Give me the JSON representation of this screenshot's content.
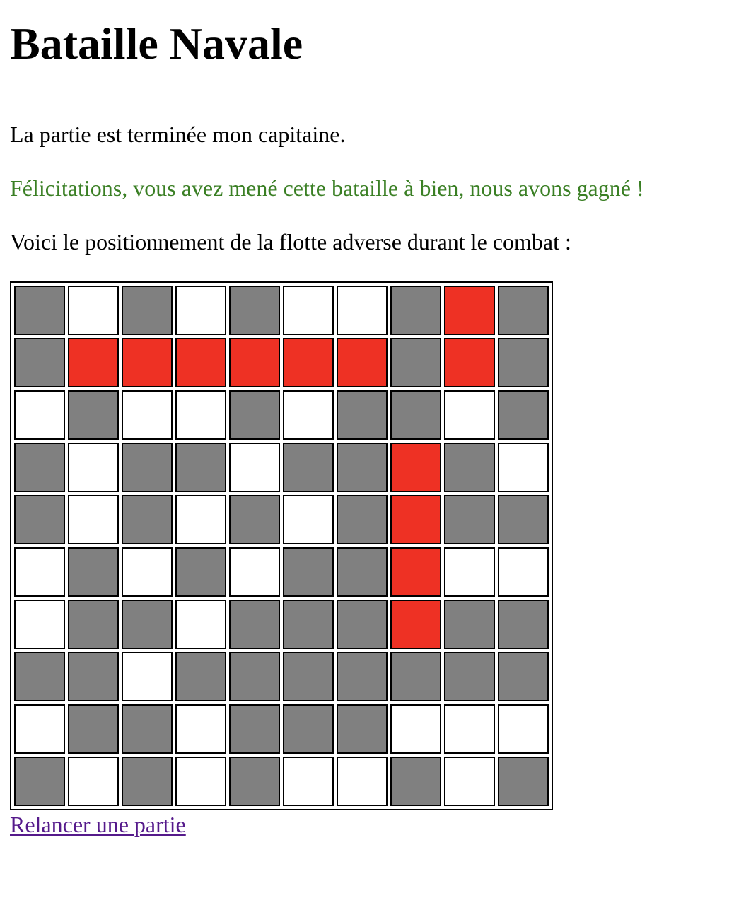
{
  "title": "Bataille Navale",
  "status_text": "La partie est terminée mon capitaine.",
  "congrats_text": "Félicitations, vous avez mené cette bataille à bien, nous avons gagné !",
  "fleet_intro": "Voici le positionnement de la flotte adverse durant le combat :",
  "restart_label": "Relancer une partie",
  "colors": {
    "congrats": "#3a7f24",
    "link": "#551a8b",
    "miss": "#808080",
    "hit": "#ee3124",
    "empty": "#ffffff"
  },
  "legend": {
    "G": "miss",
    "R": "hit",
    "W": "empty"
  },
  "grid": [
    [
      "G",
      "W",
      "G",
      "W",
      "G",
      "W",
      "W",
      "G",
      "R",
      "G"
    ],
    [
      "G",
      "R",
      "R",
      "R",
      "R",
      "R",
      "R",
      "G",
      "R",
      "G"
    ],
    [
      "W",
      "G",
      "W",
      "W",
      "G",
      "W",
      "G",
      "G",
      "W",
      "G"
    ],
    [
      "G",
      "W",
      "G",
      "G",
      "W",
      "G",
      "G",
      "R",
      "G",
      "W"
    ],
    [
      "G",
      "W",
      "G",
      "W",
      "G",
      "W",
      "G",
      "R",
      "G",
      "G"
    ],
    [
      "W",
      "G",
      "W",
      "G",
      "W",
      "G",
      "G",
      "R",
      "W",
      "W"
    ],
    [
      "W",
      "G",
      "G",
      "W",
      "G",
      "G",
      "G",
      "R",
      "G",
      "G"
    ],
    [
      "G",
      "G",
      "W",
      "G",
      "G",
      "G",
      "G",
      "G",
      "G",
      "G"
    ],
    [
      "W",
      "G",
      "G",
      "W",
      "G",
      "G",
      "G",
      "W",
      "W",
      "W"
    ],
    [
      "G",
      "W",
      "G",
      "W",
      "G",
      "W",
      "W",
      "G",
      "W",
      "G"
    ]
  ]
}
